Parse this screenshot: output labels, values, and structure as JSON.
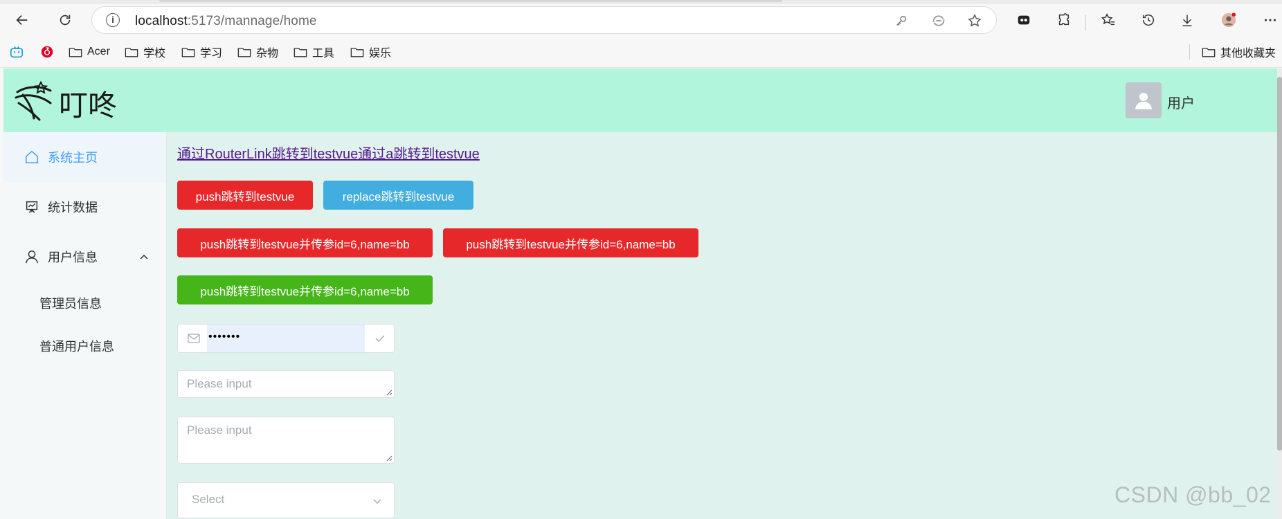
{
  "browser": {
    "url_host": "localhost",
    "url_path": ":5173/mannage/home",
    "info_glyph": "i",
    "bookmarks": [
      "Acer",
      "学校",
      "学习",
      "杂物",
      "工具",
      "娱乐"
    ],
    "other_bookmarks": "其他收藏夹"
  },
  "header": {
    "brand": "叮咚",
    "user_label": "用户"
  },
  "sidebar": {
    "items": [
      {
        "label": "系统主页",
        "icon": "house-icon",
        "active": true
      },
      {
        "label": "统计数据",
        "icon": "presentation-chart-icon"
      },
      {
        "label": "用户信息",
        "icon": "user-icon",
        "expanded": true
      }
    ],
    "sub_items": [
      "管理员信息",
      "普通用户信息"
    ]
  },
  "main": {
    "links": [
      "通过RouterLink跳转到testvue",
      "通过a跳转到testvue"
    ],
    "buttons": {
      "push": "push跳转到testvue",
      "replace": "replace跳转到testvue",
      "push_params_1": "push跳转到testvue并传参id=6,name=bb",
      "push_params_2": "push跳转到testvue并传参id=6,name=bb",
      "push_params_3": "push跳转到testvue并传参id=6,name=bb"
    },
    "password_value": "•••••••",
    "textarea1_placeholder": "Please input",
    "textarea2_placeholder": "Please input",
    "select_placeholder": "Select"
  },
  "watermark": "CSDN @bb_02",
  "colors": {
    "header_bg": "#b0f5dc",
    "content_bg": "#e0f2ee",
    "btn_red": "#e7282a",
    "btn_blue": "#42aee0",
    "btn_green": "#46b51a",
    "active_menu": "#409eff"
  }
}
